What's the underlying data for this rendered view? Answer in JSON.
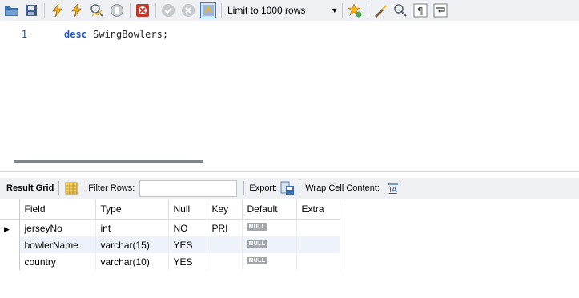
{
  "toolbar": {
    "icons": [
      "folder-open-icon",
      "save-icon",
      "execute-icon",
      "execute-current-icon",
      "explain-icon",
      "stop-icon",
      "toggle-stop-on-error-icon",
      "commit-icon",
      "rollback-icon",
      "autocommit-icon",
      "add-snippet-icon",
      "beautify-icon",
      "find-icon",
      "invisible-chars-icon",
      "word-wrap-icon"
    ],
    "limit_label": "Limit to 1000 rows"
  },
  "editor": {
    "line_number": "1",
    "keyword": "desc",
    "identifier": "SwingBowlers;"
  },
  "result_toolbar": {
    "result_grid_label": "Result Grid",
    "filter_rows_label": "Filter Rows:",
    "filter_value": "",
    "export_label": "Export:",
    "wrap_label": "Wrap Cell Content:"
  },
  "grid": {
    "columns": [
      "Field",
      "Type",
      "Null",
      "Key",
      "Default",
      "Extra"
    ],
    "null_badge": "NULL",
    "rows": [
      {
        "field": "jerseyNo",
        "type": "int",
        "null": "NO",
        "key": "PRI",
        "extra": ""
      },
      {
        "field": "bowlerName",
        "type": "varchar(15)",
        "null": "YES",
        "key": "",
        "extra": ""
      },
      {
        "field": "country",
        "type": "varchar(10)",
        "null": "YES",
        "key": "",
        "extra": ""
      }
    ]
  },
  "colors": {
    "accent": "#1f5cc8",
    "selected_row": "#eef3fb",
    "toolbar_bg": "#eef0f3"
  }
}
